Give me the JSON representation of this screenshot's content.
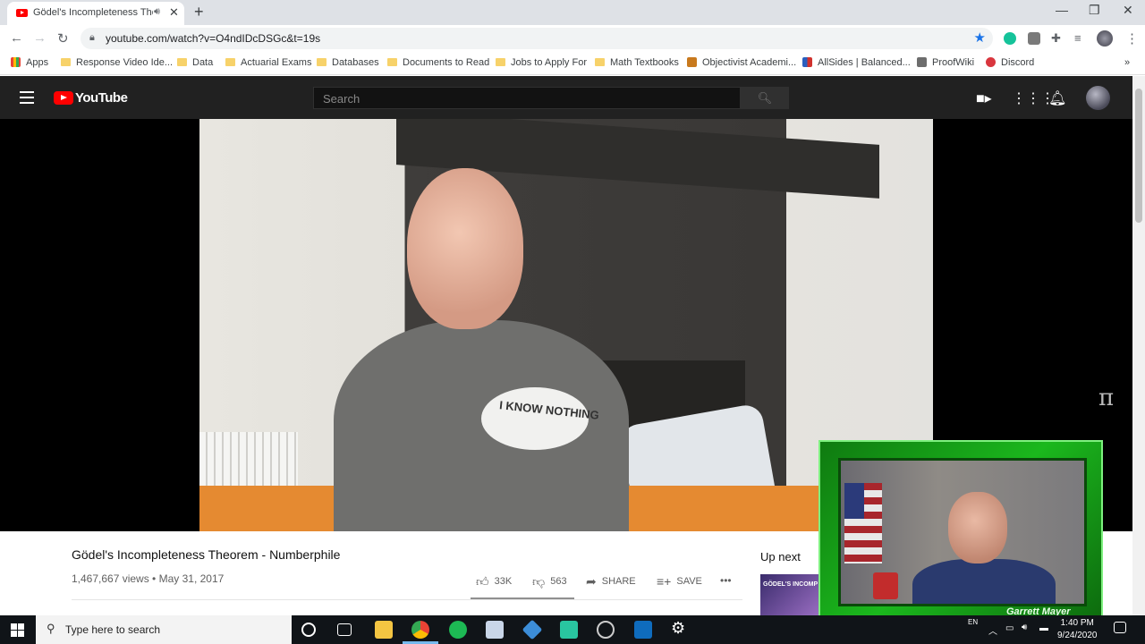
{
  "browser": {
    "tab_title": "Gödel's Incompleteness Theorem - Numberphile - YouTube",
    "new_tab_symbol": "+",
    "url": "youtube.com/watch?v=O4ndIDcDSGc&t=19s",
    "bookmarks": [
      {
        "label": "Apps",
        "kind": "apps"
      },
      {
        "label": "Response Video Ide...",
        "kind": "folder"
      },
      {
        "label": "Data",
        "kind": "folder"
      },
      {
        "label": "Actuarial Exams",
        "kind": "folder"
      },
      {
        "label": "Databases",
        "kind": "folder"
      },
      {
        "label": "Documents to Read",
        "kind": "folder"
      },
      {
        "label": "Jobs to Apply For",
        "kind": "folder"
      },
      {
        "label": "Math Textbooks",
        "kind": "folder"
      },
      {
        "label": "Objectivist Academi...",
        "kind": "site"
      },
      {
        "label": "AllSides | Balanced...",
        "kind": "site"
      },
      {
        "label": "ProofWiki",
        "kind": "site"
      },
      {
        "label": "Discord",
        "kind": "site"
      }
    ],
    "bookmarks_overflow": "»"
  },
  "youtube": {
    "logo_text": "YouTube",
    "search_placeholder": "Search",
    "video": {
      "title": "Gödel's Incompleteness Theorem - Numberphile",
      "meta": "1,467,667 views • May 31, 2017",
      "shirt_text": "I KNOW NOTHING",
      "likes": "33K",
      "dislikes": "563",
      "share_label": "SHARE",
      "save_label": "SAVE",
      "more_label": "•••",
      "watermark": "π"
    },
    "up_next_label": "Up next",
    "up_next_thumb_text": "GÖDEL'S INCOMP"
  },
  "webcam": {
    "name": "Garrett Mayer"
  },
  "taskbar": {
    "search_placeholder": "Type here to search",
    "language": "EN",
    "time": "1:40 PM",
    "date": "9/24/2020"
  },
  "colors": {
    "youtube_red": "#ff0000",
    "youtube_header": "#212121",
    "webcam_frame_green": "#1bb81d",
    "bookmark_star_blue": "#1a73e8"
  }
}
